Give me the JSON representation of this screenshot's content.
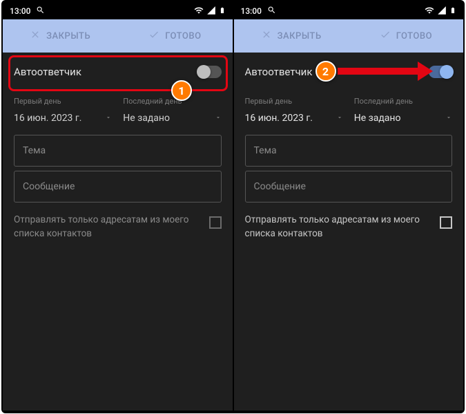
{
  "status": {
    "time": "13:00"
  },
  "topbar": {
    "close": "ЗАКРЫТЬ",
    "done": "ГОТОВО"
  },
  "autoresponder": {
    "label": "Автоответчик"
  },
  "dates": {
    "first_label": "Первый день",
    "first_value": "16 июн. 2023 г.",
    "last_label": "Последний день",
    "last_value": "Не задано"
  },
  "fields": {
    "subject_placeholder": "Тема",
    "message_placeholder": "Сообщение"
  },
  "contacts_only": "Отправлять только адресатам из моего списка контактов",
  "annotations": {
    "step1": "1",
    "step2": "2"
  }
}
